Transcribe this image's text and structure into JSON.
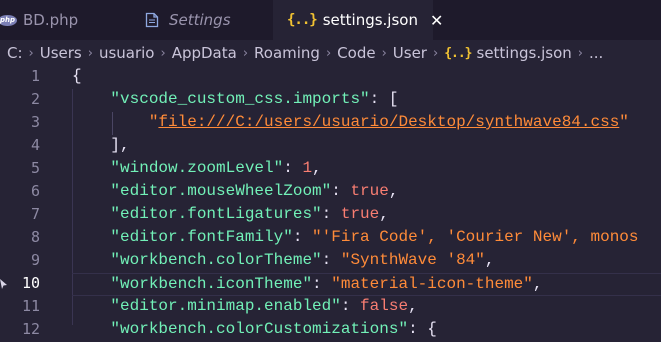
{
  "tabs": [
    {
      "label": "BD.php",
      "icon": "php-icon"
    },
    {
      "label": "Settings",
      "icon": "file-icon"
    },
    {
      "label": "settings.json",
      "icon": "braces-icon",
      "close": "✕"
    }
  ],
  "breadcrumb": [
    "C:",
    "Users",
    "usuario",
    "AppData",
    "Roaming",
    "Code",
    "User",
    "settings.json",
    "..."
  ],
  "breadcrumb_icon": "{..}",
  "editor": {
    "current_line": 10,
    "lines": [
      {
        "num": "1",
        "indent": "",
        "tokens": [
          [
            "p",
            "{"
          ]
        ]
      },
      {
        "num": "2",
        "indent": "    ",
        "tokens": [
          [
            "k",
            "\"vscode_custom_css.imports\""
          ],
          [
            "p",
            ": ["
          ]
        ]
      },
      {
        "num": "3",
        "indent": "        ",
        "tokens": [
          [
            "s",
            "\""
          ],
          [
            "u",
            "file:///C:/users/usuario/Desktop/synthwave84.css"
          ],
          [
            "s",
            "\""
          ]
        ]
      },
      {
        "num": "4",
        "indent": "    ",
        "tokens": [
          [
            "p",
            "],"
          ]
        ]
      },
      {
        "num": "5",
        "indent": "    ",
        "tokens": [
          [
            "k",
            "\"window.zoomLevel\""
          ],
          [
            "p",
            ": "
          ],
          [
            "n",
            "1"
          ],
          [
            "p",
            ","
          ]
        ]
      },
      {
        "num": "6",
        "indent": "    ",
        "tokens": [
          [
            "k",
            "\"editor.mouseWheelZoom\""
          ],
          [
            "p",
            ": "
          ],
          [
            "n",
            "true"
          ],
          [
            "p",
            ","
          ]
        ]
      },
      {
        "num": "7",
        "indent": "    ",
        "tokens": [
          [
            "k",
            "\"editor.fontLigatures\""
          ],
          [
            "p",
            ": "
          ],
          [
            "n",
            "true"
          ],
          [
            "p",
            ","
          ]
        ]
      },
      {
        "num": "8",
        "indent": "    ",
        "tokens": [
          [
            "k",
            "\"editor.fontFamily\""
          ],
          [
            "p",
            ": "
          ],
          [
            "s",
            "\"'Fira Code', 'Courier New', monos"
          ]
        ]
      },
      {
        "num": "9",
        "indent": "    ",
        "tokens": [
          [
            "k",
            "\"workbench.colorTheme\""
          ],
          [
            "p",
            ": "
          ],
          [
            "s",
            "\"SynthWave '84\""
          ],
          [
            "p",
            ","
          ]
        ]
      },
      {
        "num": "10",
        "indent": "    ",
        "tokens": [
          [
            "k",
            "\"workbench.iconTheme\""
          ],
          [
            "p",
            ": "
          ],
          [
            "s",
            "\"material-icon-theme\""
          ],
          [
            "p",
            ","
          ]
        ]
      },
      {
        "num": "11",
        "indent": "    ",
        "tokens": [
          [
            "k",
            "\"editor.minimap.enabled\""
          ],
          [
            "p",
            ": "
          ],
          [
            "n",
            "false"
          ],
          [
            "p",
            ","
          ]
        ]
      },
      {
        "num": "12",
        "indent": "    ",
        "tokens": [
          [
            "k",
            "\"workbench.colorCustomizations\""
          ],
          [
            "p",
            ": {"
          ]
        ]
      }
    ]
  },
  "colors": {
    "background": "#262335",
    "tabbar": "#1e1a2b",
    "key": "#72f1b8",
    "string": "#ff8b39",
    "literal": "#f97e72",
    "braces_icon": "#f1c232"
  }
}
